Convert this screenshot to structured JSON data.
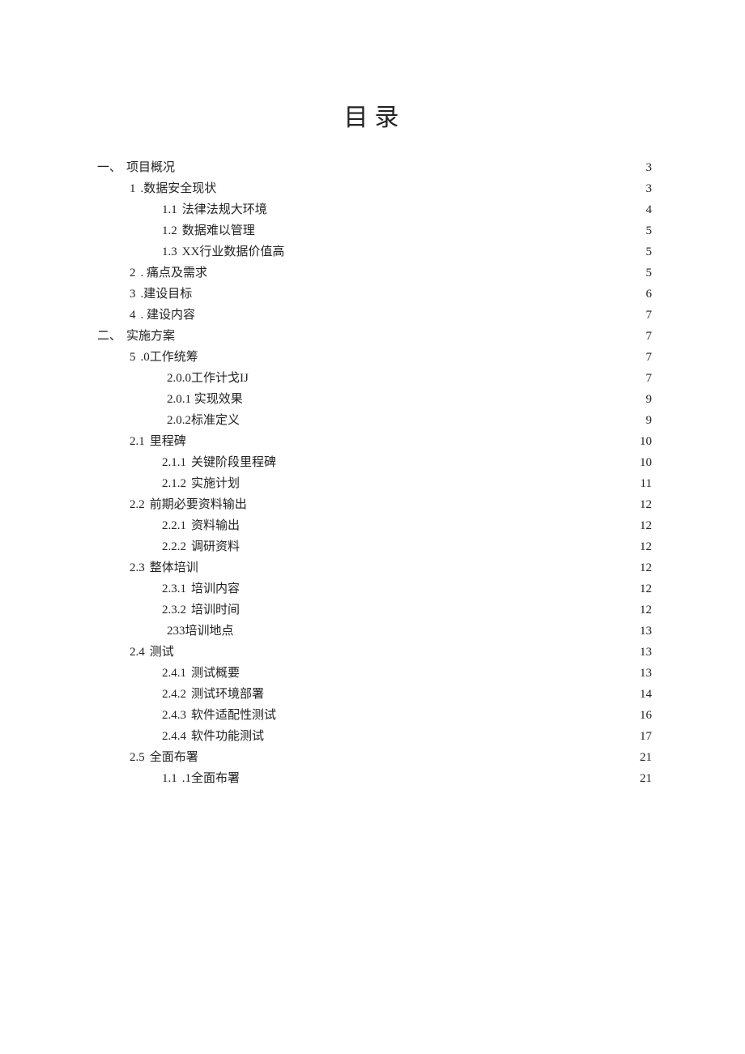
{
  "title": "目录",
  "toc": [
    {
      "indent": 0,
      "prefix": "一、",
      "label": "项目概况",
      "page": "3"
    },
    {
      "indent": 1,
      "prefix": "1",
      "label": ".数据安全现状",
      "page": "3"
    },
    {
      "indent": 2,
      "prefix": "1.1",
      "label": "法律法规大环境",
      "page": "4"
    },
    {
      "indent": 2,
      "prefix": "1.2",
      "label": "数据难以管理",
      "page": "5"
    },
    {
      "indent": 2,
      "prefix": "1.3",
      "label": "XX行业数据价值高",
      "page": "5"
    },
    {
      "indent": 1,
      "prefix": "2",
      "label": ". 痛点及需求",
      "page": "5"
    },
    {
      "indent": 1,
      "prefix": "3",
      "label": ".建设目标",
      "page": "6"
    },
    {
      "indent": 1,
      "prefix": "4",
      "label": ". 建设内容",
      "page": "7"
    },
    {
      "indent": 0,
      "prefix": "二、",
      "label": "实施方案",
      "page": "7"
    },
    {
      "indent": 1,
      "prefix": "5",
      "label": ".0工作统筹",
      "page": "7"
    },
    {
      "indent": 2,
      "prefix": "",
      "label": "2.0.0工作计戈IJ",
      "page": "7"
    },
    {
      "indent": 2,
      "prefix": "",
      "label": "2.0.1 实现效果",
      "page": "9"
    },
    {
      "indent": 2,
      "prefix": "",
      "label": "2.0.2标准定义",
      "page": "9"
    },
    {
      "indent": 1,
      "prefix": "2.1",
      "label": "里程碑",
      "page": "10"
    },
    {
      "indent": 2,
      "prefix": "2.1.1",
      "label": "关键阶段里程碑",
      "page": "10"
    },
    {
      "indent": 2,
      "prefix": "2.1.2",
      "label": "实施计划",
      "page": "11"
    },
    {
      "indent": 1,
      "prefix": "2.2",
      "label": "前期必要资料输出",
      "page": "12"
    },
    {
      "indent": 2,
      "prefix": "2.2.1",
      "label": "资料输出",
      "page": "12"
    },
    {
      "indent": 2,
      "prefix": "2.2.2",
      "label": "调研资料",
      "page": "12"
    },
    {
      "indent": 1,
      "prefix": "2.3",
      "label": "整体培训",
      "page": "12"
    },
    {
      "indent": 2,
      "prefix": "2.3.1",
      "label": "培训内容",
      "page": "12"
    },
    {
      "indent": 2,
      "prefix": "2.3.2",
      "label": "培训时间",
      "page": "12"
    },
    {
      "indent": 2,
      "prefix": "",
      "label": "233培训地点",
      "page": "13"
    },
    {
      "indent": 1,
      "prefix": "2.4",
      "label": "测试",
      "page": "13"
    },
    {
      "indent": 2,
      "prefix": "2.4.1",
      "label": "测试概要",
      "page": "13"
    },
    {
      "indent": 2,
      "prefix": "2.4.2",
      "label": "测试环境部署",
      "page": "14"
    },
    {
      "indent": 2,
      "prefix": "2.4.3",
      "label": "软件适配性测试",
      "page": "16"
    },
    {
      "indent": 2,
      "prefix": "2.4.4",
      "label": "软件功能测试",
      "page": "17"
    },
    {
      "indent": 1,
      "prefix": "2.5",
      "label": "全面布署",
      "page": "21"
    },
    {
      "indent": 2,
      "prefix": "1.1",
      "label": ".1全面布署",
      "page": "21"
    }
  ]
}
